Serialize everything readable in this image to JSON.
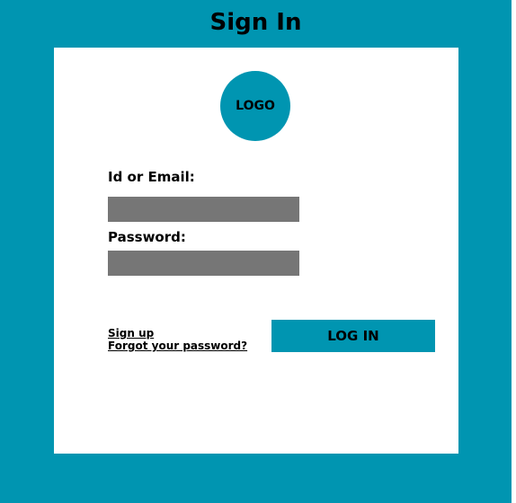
{
  "header": {
    "title": "Sign In"
  },
  "logo": {
    "text": "LOGO"
  },
  "form": {
    "id_label": "Id or Email:",
    "id_value": "",
    "password_label": "Password:",
    "password_value": ""
  },
  "links": {
    "sign_up": "Sign up",
    "forgot_password": "Forgot your password?"
  },
  "actions": {
    "login_label": "LOG IN"
  },
  "colors": {
    "accent": "#0095b1",
    "input_fill": "#767676",
    "card": "#ffffff",
    "text": "#000000"
  }
}
